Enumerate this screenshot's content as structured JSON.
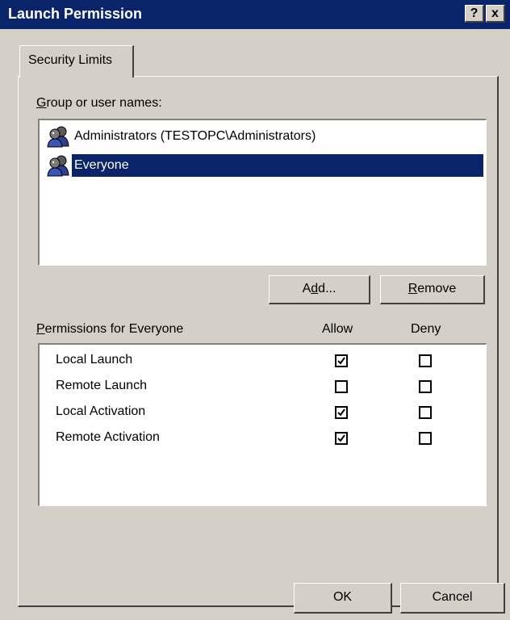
{
  "window": {
    "title": "Launch Permission",
    "help_button": "?",
    "close_button": "x"
  },
  "tabs": [
    {
      "label": "Security Limits"
    }
  ],
  "groups": {
    "label": "Group or user names:",
    "items": [
      {
        "label": "Administrators (TESTOPC\\Administrators)",
        "selected": false,
        "icon": "users-group-icon"
      },
      {
        "label": "Everyone",
        "selected": true,
        "icon": "users-group-icon"
      }
    ]
  },
  "buttons": {
    "add": "Add...",
    "remove": "Remove",
    "ok": "OK",
    "cancel": "Cancel"
  },
  "permissions": {
    "label": "Permissions for Everyone",
    "allow_header": "Allow",
    "deny_header": "Deny",
    "rows": [
      {
        "name": "Local Launch",
        "allow": true,
        "deny": false
      },
      {
        "name": "Remote Launch",
        "allow": false,
        "deny": false
      },
      {
        "name": "Local Activation",
        "allow": true,
        "deny": false
      },
      {
        "name": "Remote Activation",
        "allow": true,
        "deny": false
      }
    ]
  },
  "colors": {
    "titlebar": "#0a246a",
    "face": "#d4d0c8",
    "selection": "#0a246a"
  }
}
